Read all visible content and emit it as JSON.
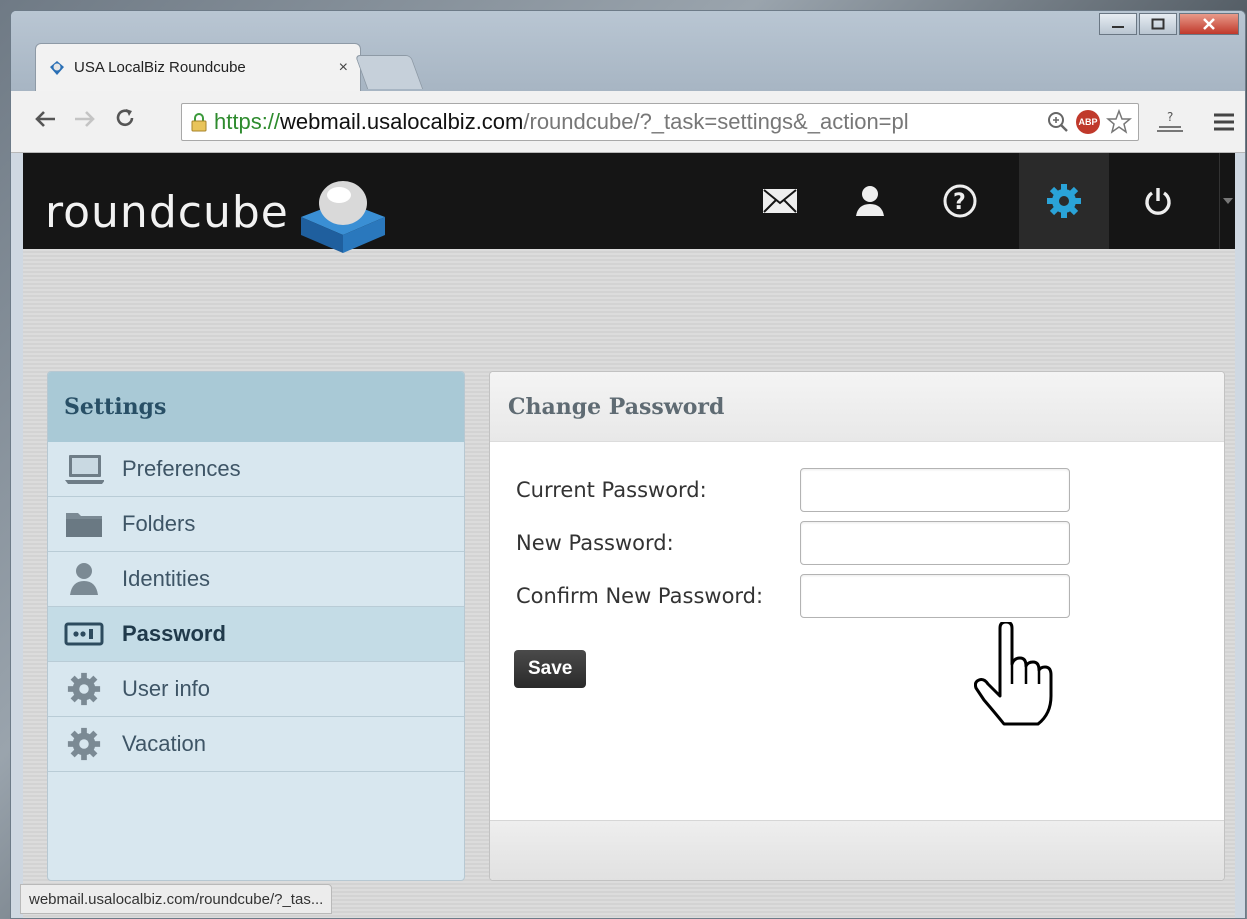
{
  "browser": {
    "tab_title": "USA LocalBiz Roundcube ",
    "tab_close": "×",
    "url_scheme": "https://",
    "url_host": "webmail.usalocalbiz.com",
    "url_path": "/roundcube/?_task=settings&_action=pl",
    "status_text": "webmail.usalocalbiz.com/roundcube/?_tas..."
  },
  "app": {
    "logo": "roundcube",
    "nav": [
      {
        "name": "mail",
        "icon": "envelope-icon"
      },
      {
        "name": "contacts",
        "icon": "person-icon"
      },
      {
        "name": "help",
        "icon": "question-icon"
      },
      {
        "name": "settings",
        "icon": "gear-icon",
        "active": true
      },
      {
        "name": "logout",
        "icon": "power-icon"
      }
    ]
  },
  "sidebar": {
    "title": "Settings",
    "items": [
      {
        "label": "Preferences",
        "icon": "laptop-icon"
      },
      {
        "label": "Folders",
        "icon": "folder-icon"
      },
      {
        "label": "Identities",
        "icon": "person-icon"
      },
      {
        "label": "Password",
        "icon": "password-icon",
        "selected": true
      },
      {
        "label": "User info",
        "icon": "gear-icon"
      },
      {
        "label": "Vacation",
        "icon": "gear-icon"
      }
    ]
  },
  "main": {
    "title": "Change Password",
    "fields": [
      {
        "label": "Current Password:",
        "value": ""
      },
      {
        "label": "New Password:",
        "value": ""
      },
      {
        "label": "Confirm New Password:",
        "value": ""
      }
    ],
    "save_label": "Save"
  },
  "colors": {
    "accent": "#2aa3d8",
    "topbar": "#151515",
    "sidebar_bg": "#d8e7ef",
    "sidebar_header": "#a9c9d6"
  }
}
